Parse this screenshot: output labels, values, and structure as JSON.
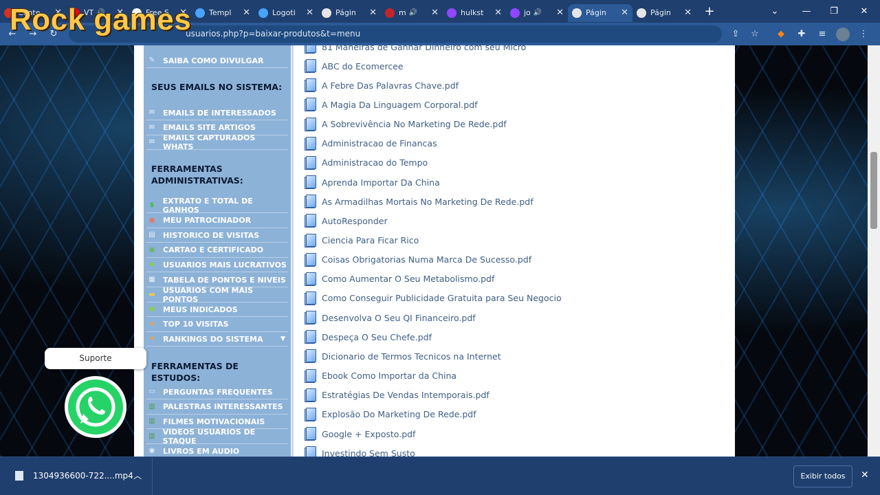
{
  "overlay": {
    "title": "Rock games"
  },
  "tabs": [
    {
      "label": "Conte",
      "fav": "#d93025",
      "sound": false,
      "active": false
    },
    {
      "label": "VT",
      "fav": "#ff0000",
      "sound": true,
      "active": false
    },
    {
      "label": "Free S",
      "fav": "#ffffff",
      "sound": false,
      "active": false
    },
    {
      "label": "Templ",
      "fav": "#4aa3ff",
      "sound": false,
      "active": false
    },
    {
      "label": "Logoti",
      "fav": "#4aa3ff",
      "sound": false,
      "active": false
    },
    {
      "label": "Págin",
      "fav": "#e6e6e6",
      "sound": false,
      "active": false
    },
    {
      "label": "m",
      "fav": "#c4252b",
      "sound": true,
      "active": false
    },
    {
      "label": "hulkst",
      "fav": "#9146ff",
      "sound": false,
      "active": false
    },
    {
      "label": "jo",
      "fav": "#9146ff",
      "sound": true,
      "active": false
    },
    {
      "label": "Págin",
      "fav": "#e6e6e6",
      "sound": false,
      "active": true
    },
    {
      "label": "Págin",
      "fav": "#e6e6e6",
      "sound": false,
      "active": false
    }
  ],
  "address": {
    "url": "usuarios.php?p=baixar-produtos&t=menu"
  },
  "sidebar": {
    "top_item": "SAIBA COMO DIVULGAR",
    "section1": "SEUS EMAILS NO SISTEMA:",
    "emails": [
      "EMAILS DE INTERESSADOS",
      "EMAILS SITE ARTIGOS",
      "EMAILS CAPTURADOS WHATS"
    ],
    "section2": "FERRAMENTAS ADMINISTRATIVAS:",
    "admin": [
      {
        "label": "EXTRATO E TOTAL DE GANHOS",
        "icon": "$",
        "icon_name": "dollar-icon",
        "color": "#3fbf3f"
      },
      {
        "label": "MEU PATROCINADOR",
        "icon": "●",
        "icon_name": "user-icon",
        "color": "#e07b6c"
      },
      {
        "label": "HISTORICO DE VISITAS",
        "icon": "▤",
        "icon_name": "history-icon",
        "color": "#e8f0fa"
      },
      {
        "label": "CARTAO E CERTIFICADO",
        "icon": "▣",
        "icon_name": "certificate-icon",
        "color": "#6fb35c"
      },
      {
        "label": "USUARIOS MAIS LUCRATIVOS",
        "icon": "◆",
        "icon_name": "money-icon",
        "color": "#8acb5a"
      },
      {
        "label": "TABELA DE PONTOS E NIVEIS",
        "icon": "▦",
        "icon_name": "table-icon",
        "color": "#e8f0fa"
      },
      {
        "label": "USUARIOS COM MAIS PONTOS",
        "icon": "▬",
        "icon_name": "folder-icon",
        "color": "#f2c94c"
      },
      {
        "label": "MEUS INDICADOS",
        "icon": "●",
        "icon_name": "users-icon",
        "color": "#8acb5a"
      },
      {
        "label": "TOP 10 VISITAS",
        "icon": "★",
        "icon_name": "trophy-icon",
        "color": "#f2a33a"
      },
      {
        "label": "RANKINGS DO SISTEMA",
        "icon": "★",
        "icon_name": "ranking-icon",
        "color": "#f2a33a"
      }
    ],
    "section3": "FERRAMENTAS DE ESTUDOS:",
    "studies": [
      {
        "label": "PERGUNTAS FREQUENTES",
        "icon": "▭",
        "icon_name": "faq-icon",
        "color": "#e8f0fa"
      },
      {
        "label": "PALESTRAS INTERESSANTES",
        "icon": "▥",
        "icon_name": "film-icon",
        "color": "#4c9a4c"
      },
      {
        "label": "FILMES MOTIVACIONAIS",
        "icon": "▥",
        "icon_name": "film-icon",
        "color": "#4c9a4c"
      },
      {
        "label": "VIDEOS USUARIOS DE STAQUE",
        "icon": "▥",
        "icon_name": "film-icon",
        "color": "#4c9a4c"
      },
      {
        "label": "LIVROS EM AUDIO",
        "icon": "◉",
        "icon_name": "audio-icon",
        "color": "#e8f0fa"
      }
    ]
  },
  "files": [
    "81 Maneiras de Ganhar Dinheiro com seu Micro",
    "ABC do Ecomercee",
    "A Febre Das Palavras Chave.pdf",
    "A Magia Da Linguagem Corporal.pdf",
    "A Sobrevivência No Marketing De Rede.pdf",
    "Administracao de Financas",
    "Administracao do Tempo",
    "Aprenda Importar Da China",
    "As Armadilhas Mortais No Marketing De Rede.pdf",
    "AutoResponder",
    "Ciencia Para Ficar Rico",
    "Coisas Obrigatorias Numa Marca De Sucesso.pdf",
    "Como Aumentar O Seu Metabolismo.pdf",
    "Como Conseguir Publicidade Gratuita para Seu Negocio",
    "Desenvolva O Seu QI Financeiro.pdf",
    "Despeça O Seu Chefe.pdf",
    "Dicionario de Termos Tecnicos na Internet",
    "Ebook Como Importar da China",
    "Estratégias De Vendas Intemporais.pdf",
    "Explosão Do Marketing De Rede.pdf",
    "Google + Exposto.pdf",
    "Investindo Sem Susto"
  ],
  "support": {
    "label": "Suporte"
  },
  "download": {
    "filename": "1304936600-722....mp4",
    "show_all": "Exibir todos"
  }
}
